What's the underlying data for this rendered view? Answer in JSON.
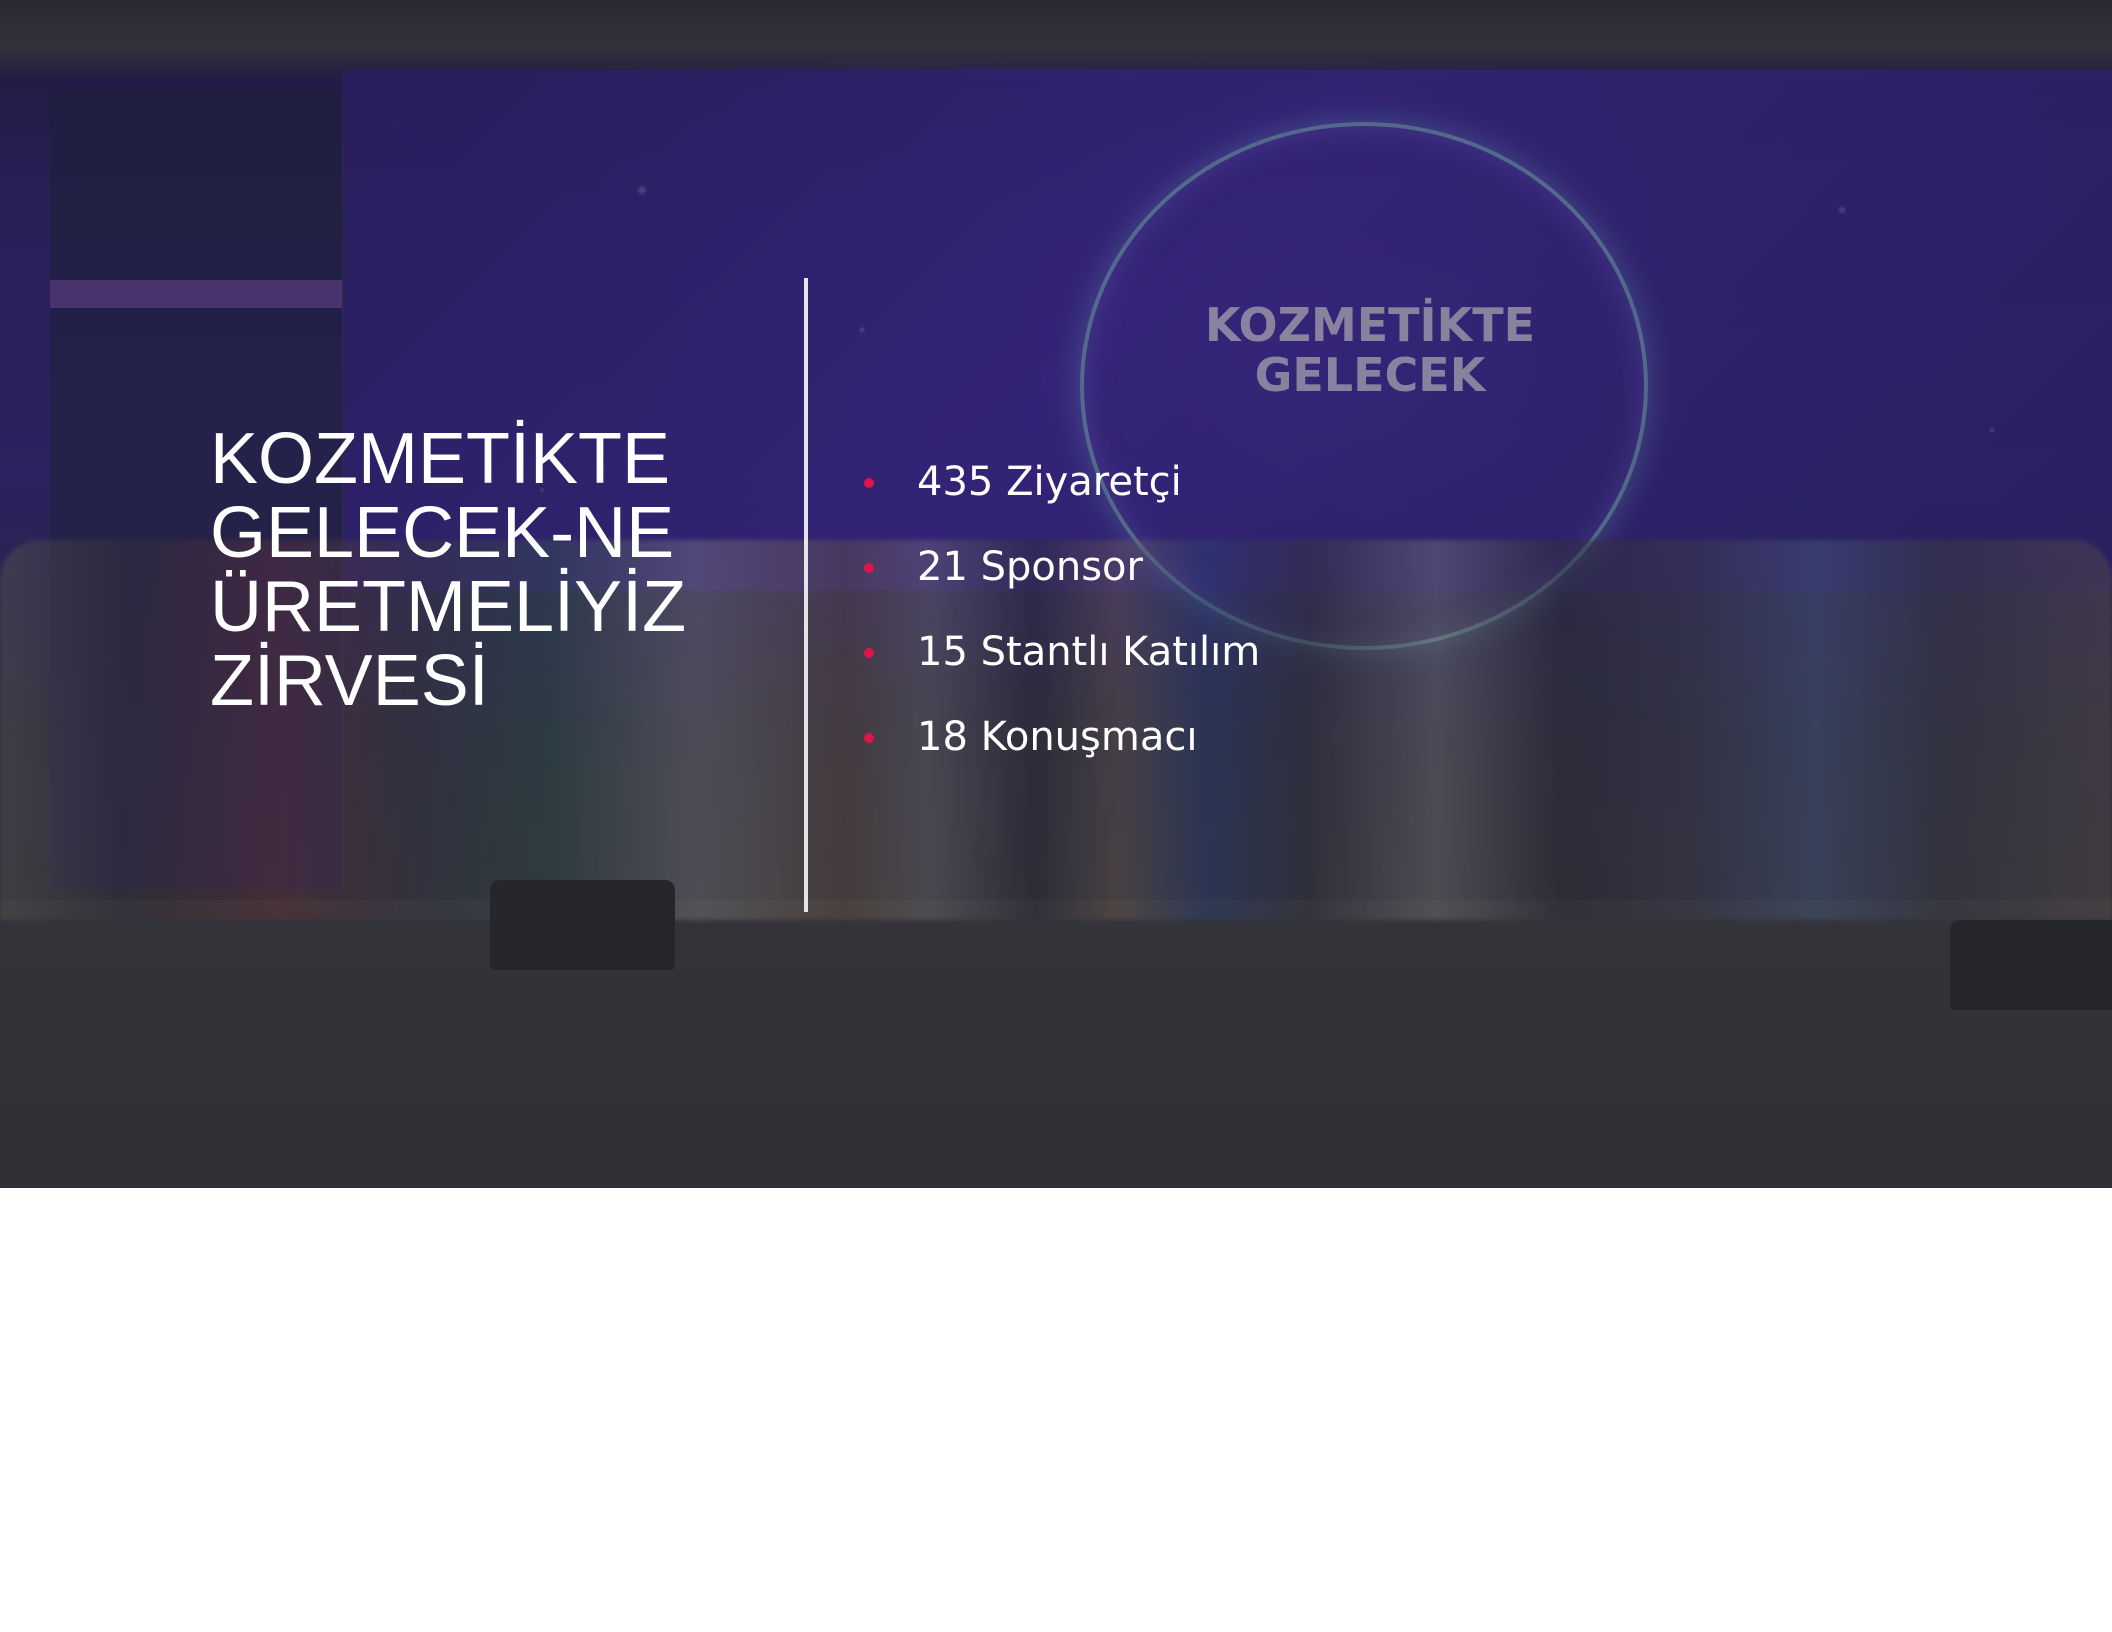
{
  "slide": {
    "title_lines": [
      "KOZMETİKTE",
      "GELECEK-NE",
      "ÜRETMELİYİZ",
      "ZİRVESİ"
    ],
    "stats": [
      "435 Ziyaretçi",
      "21 Sponsor",
      "15 Stantlı Katılım",
      "18 Konuşmacı"
    ],
    "bullet_color": "#e0134a",
    "background_photo": {
      "stage_logo_lines": [
        "KOZMETİKTE",
        "GELECEK"
      ]
    }
  }
}
